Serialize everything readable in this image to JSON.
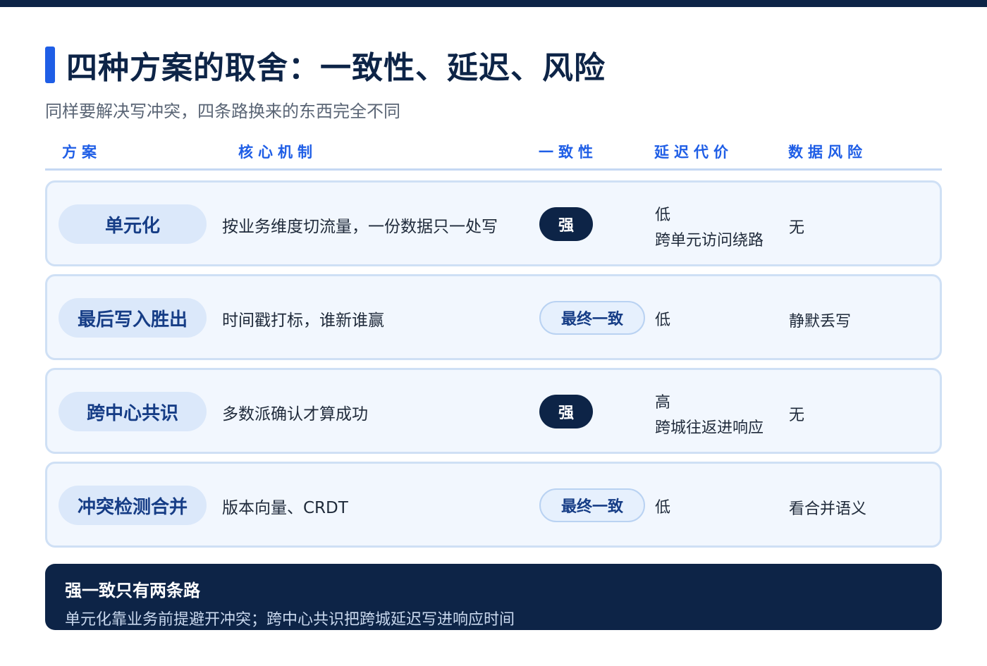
{
  "page": {
    "title": "四种方案的取舍：一致性、延迟、风险",
    "subtitle": "同样要解决写冲突，四条路换来的东西完全不同"
  },
  "table": {
    "headers": {
      "scheme": "方案",
      "mechanism": "核心机制",
      "consistency": "一致性",
      "latency": "延迟代价",
      "risk": "数据风险"
    },
    "rows": [
      {
        "name": "单元化",
        "mechanism": "按业务维度切流量，一份数据只一处写",
        "consistency": "强",
        "latency_line1": "低",
        "latency_line2": "跨单元访问绕路",
        "risk": "无"
      },
      {
        "name": "最后写入胜出",
        "mechanism": "时间戳打标，谁新谁赢",
        "consistency": "最终一致",
        "latency_line1": "低",
        "risk": "静默丢写"
      },
      {
        "name": "跨中心共识",
        "mechanism": "多数派确认才算成功",
        "consistency": "强",
        "latency_line1": "高",
        "latency_line2": "跨城往返进响应",
        "risk": "无"
      },
      {
        "name": "冲突检测合并",
        "mechanism": "版本向量、CRDT",
        "consistency": "最终一致",
        "latency_line1": "低",
        "risk": "看合并语义"
      }
    ]
  },
  "callout": {
    "title": "强一致只有两条路",
    "text": "单元化靠业务前提避开冲突；跨中心共识把跨城延迟写进响应时间"
  },
  "colors": {
    "navy": "#0d2447",
    "accent_blue": "#1f5ee6",
    "row_bg": "#f2f7fe",
    "pill_bg": "#dbe8fa"
  }
}
